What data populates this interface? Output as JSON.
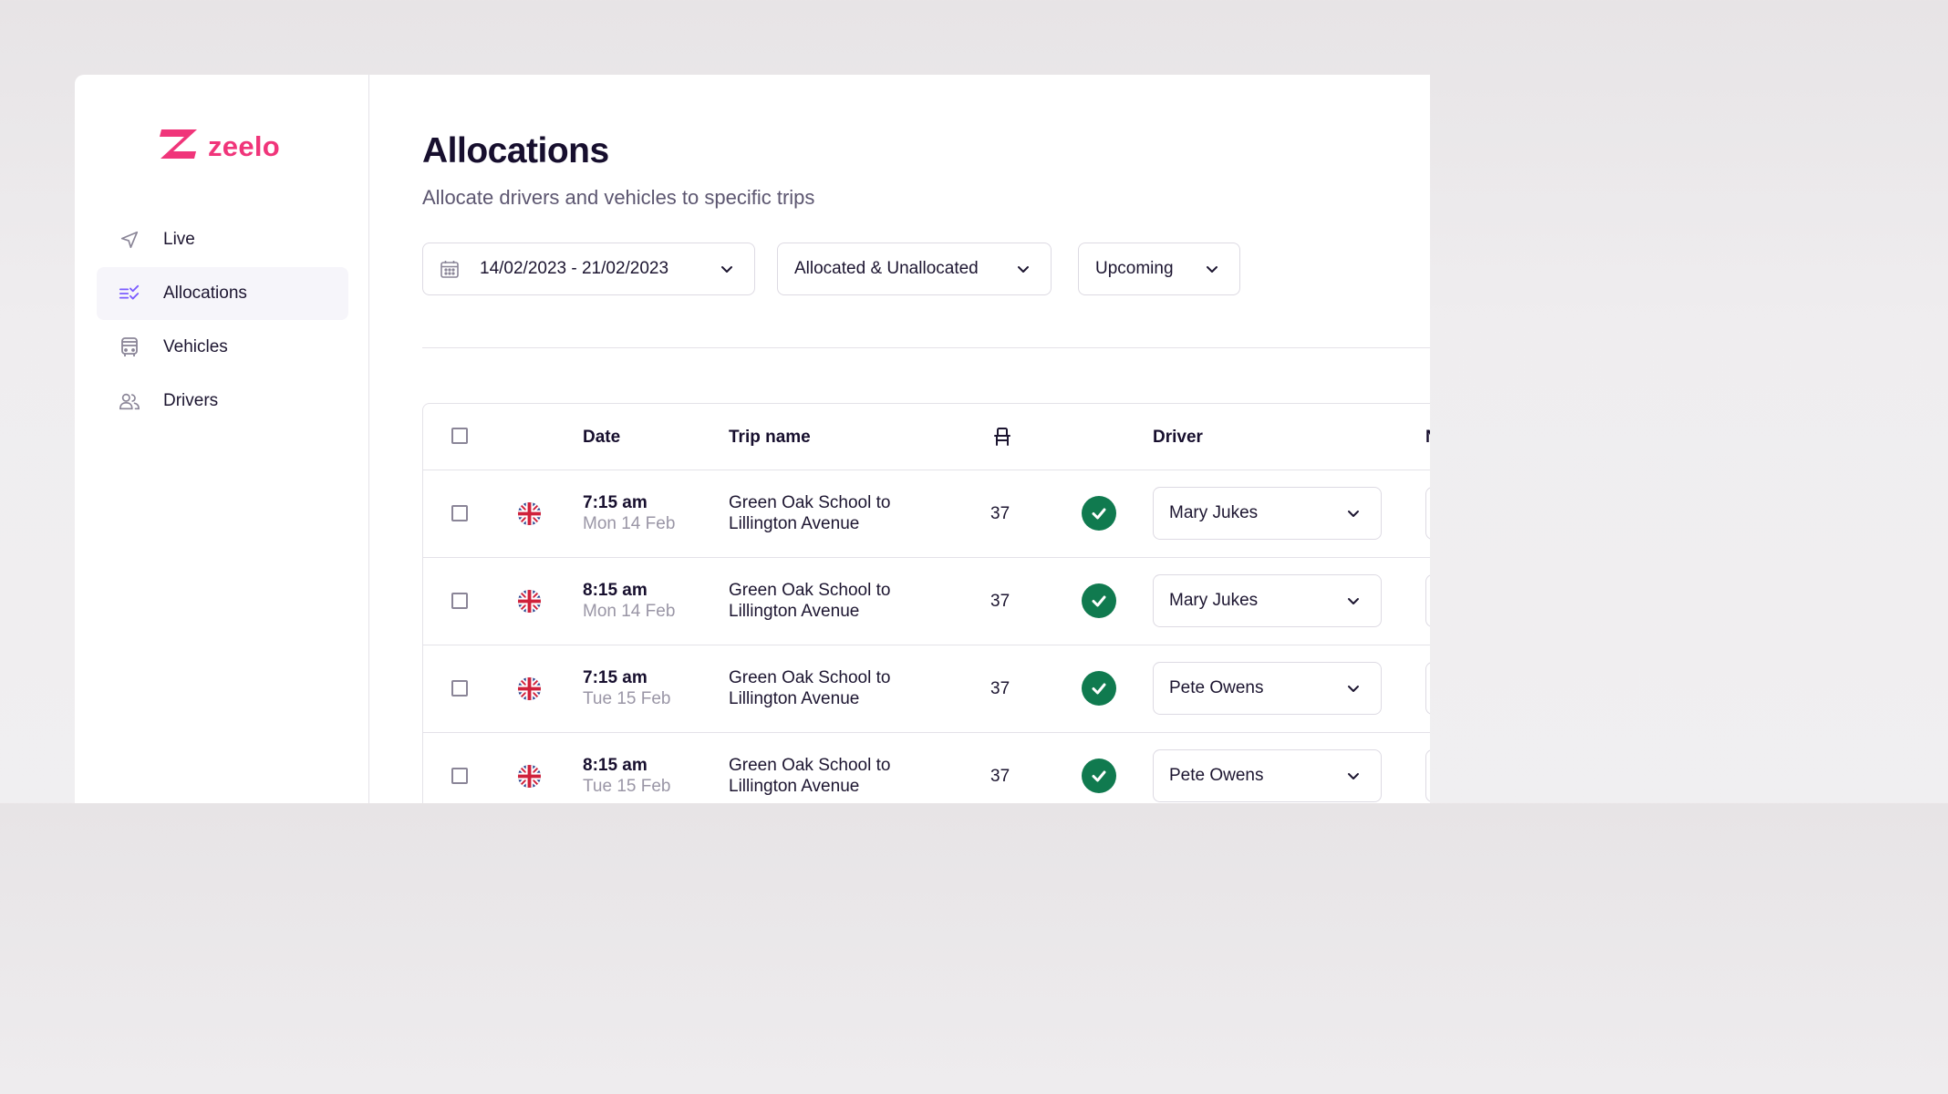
{
  "brand": {
    "name": "zeelo",
    "color": "#f0357a"
  },
  "sidebar": {
    "items": [
      {
        "label": "Live",
        "icon": "send-icon",
        "active": false
      },
      {
        "label": "Allocations",
        "icon": "list-check-icon",
        "active": true
      },
      {
        "label": "Vehicles",
        "icon": "bus-icon",
        "active": false
      },
      {
        "label": "Drivers",
        "icon": "users-icon",
        "active": false
      }
    ]
  },
  "page": {
    "title": "Allocations",
    "subtitle": "Allocate drivers and vehicles to specific trips"
  },
  "filters": {
    "date_range": "14/02/2023 - 21/02/2023",
    "allocation_status": "Allocated & Unallocated",
    "time_scope": "Upcoming"
  },
  "table": {
    "columns": {
      "date": "Date",
      "trip_name": "Trip name",
      "seats": "seat-icon",
      "driver": "Driver",
      "next_partial": "N"
    },
    "rows": [
      {
        "time": "7:15 am",
        "date": "Mon 14 Feb",
        "trip_line1": "Green Oak School to",
        "trip_line2": "Lillington Avenue",
        "seats": "37",
        "driver": "Mary Jukes",
        "status": "allocated"
      },
      {
        "time": "8:15 am",
        "date": "Mon 14 Feb",
        "trip_line1": "Green Oak School to",
        "trip_line2": "Lillington Avenue",
        "seats": "37",
        "driver": "Mary Jukes",
        "status": "allocated"
      },
      {
        "time": "7:15 am",
        "date": "Tue 15 Feb",
        "trip_line1": "Green Oak School to",
        "trip_line2": "Lillington Avenue",
        "seats": "37",
        "driver": "Pete Owens",
        "status": "allocated"
      },
      {
        "time": "8:15 am",
        "date": "Tue 15 Feb",
        "trip_line1": "Green Oak School to",
        "trip_line2": "Lillington Avenue",
        "seats": "37",
        "driver": "Pete Owens",
        "status": "allocated"
      }
    ]
  },
  "colors": {
    "accent_purple": "#7b5cff",
    "success_green": "#107a4f",
    "text_primary": "#170f2e",
    "text_muted": "#9a96a6"
  }
}
